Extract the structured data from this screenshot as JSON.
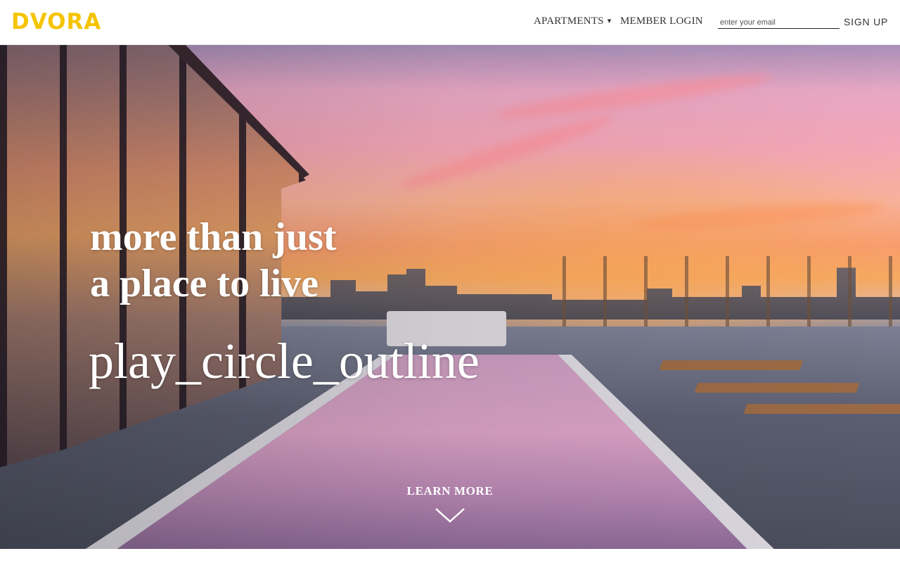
{
  "header": {
    "logo_text": "DVORA",
    "brand_color": "#f5c400",
    "nav": {
      "apartments_label": "APARTMENTS",
      "apartments_icon": "caret-down-icon",
      "login_label": "MEMBER LOGIN"
    },
    "signup": {
      "email_placeholder": "enter your email",
      "email_value": "",
      "button_label": "SIGN UP"
    }
  },
  "hero": {
    "headline_line1": "more than just",
    "headline_line2": "a place to live",
    "play_icon_text": "play_circle_outline",
    "learn_more_label": "LEARN MORE",
    "learn_more_icon": "chevron-down-icon"
  }
}
